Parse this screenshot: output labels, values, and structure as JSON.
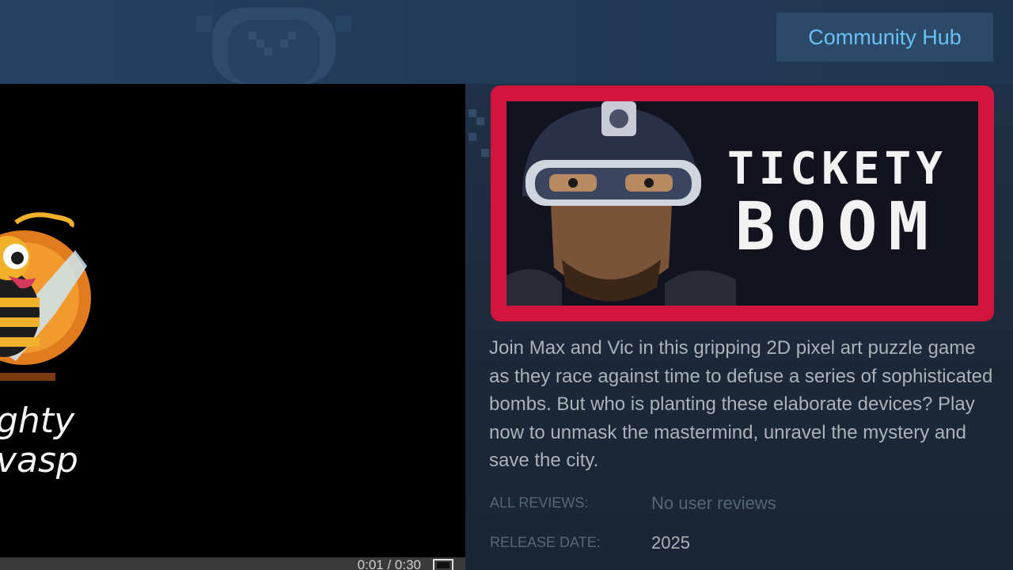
{
  "header": {
    "community_hub_label": "Community Hub"
  },
  "video": {
    "time": "0:01 / 0:30",
    "logo_text_line1": "ghty",
    "logo_text_line2": "vasp",
    "progress_fraction": 0.033
  },
  "capsule": {
    "title_line1": "TICKETY",
    "title_line2": "BOOM",
    "highlight_color": "#d2153c"
  },
  "description": "Join Max and Vic in this gripping 2D pixel art puzzle game as they race against time to defuse a series of sophisticated bombs. But who is planting these elaborate devices? Play now to unmask the mastermind, unravel the mystery and save the city.",
  "meta": {
    "reviews_label": "ALL REVIEWS:",
    "reviews_value": "No user reviews",
    "release_label": "RELEASE DATE:",
    "release_value": "2025"
  },
  "colors": {
    "background": "#1b2838",
    "accent_link": "#67c1f5",
    "text_primary": "#acb2b8",
    "text_muted": "#556772"
  },
  "icons": [
    "clock-icon",
    "fullscreen-icon",
    "police-badge-icon"
  ]
}
